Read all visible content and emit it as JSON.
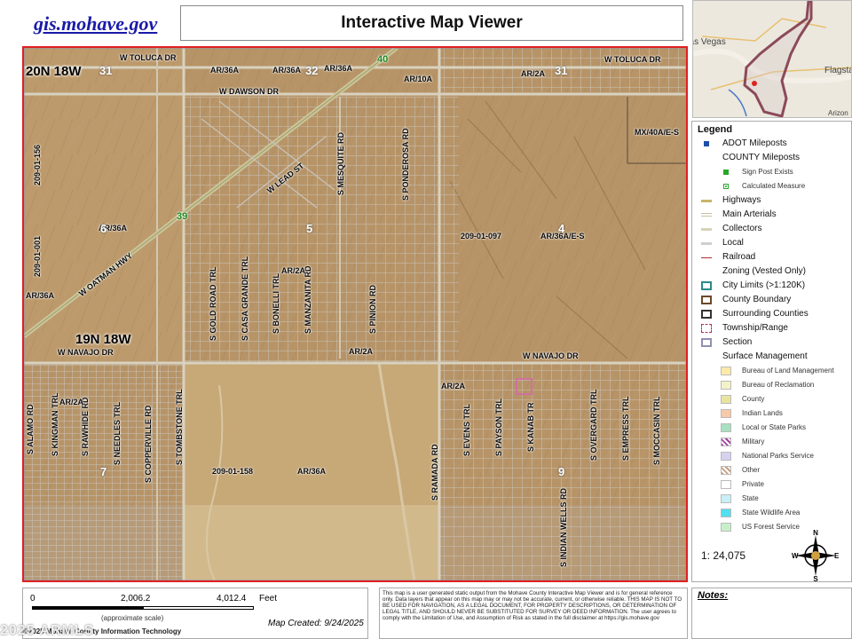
{
  "header": {
    "logo": "gis.mohave.gov",
    "title": "Interactive Map Viewer"
  },
  "overview": {
    "labels": [
      "Las Vegas",
      "Flagstaff",
      "Arizon"
    ]
  },
  "map": {
    "roads": {
      "toluca_w": "W TOLUCA DR",
      "toluca_e": "W TOLUCA DR",
      "dawson": "W DAWSON DR",
      "lead": "W LEAD ST",
      "oatman": "W OATMAN HWY",
      "navajo_w": "W NAVAJO DR",
      "navajo_e": "W NAVAJO DR",
      "mesquite": "S MESQUITE RD",
      "ponderosa": "S PONDEROSA RD",
      "gold_road": "S GOLD ROAD TRL",
      "casa_grande": "S CASA GRANDE TRL",
      "bonelli": "S BONELLI TRL",
      "manzanita": "S MANZANITA RD",
      "pinion": "S PINION RD",
      "kingman": "S KINGMAN TRL",
      "rawhide": "S RAWHIDE RD",
      "needles": "S NEEDLES TRL",
      "copperville": "S COPPERVILLE RD",
      "tombstone": "S TOMBSTONE TRL",
      "ramada": "S RAMADA RD",
      "evens": "S EVENS TRL",
      "payson": "S PAYSON TRL",
      "kanab": "S KANAB TR",
      "indian_wells": "S INDIAN WELLS RD",
      "overgard": "S OVERGARD TRL",
      "empress": "S EMPRESS TRL",
      "moccasin": "S MOCCASIN TRL",
      "alamo": "S ALAMO RD"
    },
    "zoning": {
      "ar36a": "AR/36A",
      "ar2a": "AR/2A",
      "ar10a": "AR/10A",
      "ar36aes": "AR/36A/E-S",
      "mx40aes": "MX/40A/E-S"
    },
    "parcels": {
      "p097": "209-01-097",
      "p158": "209-01-158",
      "p156": "209-01-156",
      "p001": "209-01-001"
    },
    "township": {
      "t20n": "20N 18W",
      "t19n": "19N 18W"
    },
    "sections": {
      "s31": "31",
      "s32": "32",
      "s31b": "31",
      "s6": "6",
      "s5": "5",
      "s4": "4",
      "s7": "7",
      "s9": "9"
    },
    "mileposts": {
      "m40": "40",
      "m39": "39"
    }
  },
  "legend": {
    "title": "Legend",
    "items": [
      {
        "label": "ADOT Mileposts",
        "style": "sq",
        "color": "#1f4fa8",
        "small": false
      },
      {
        "label": "COUNTY Mileposts",
        "style": "none",
        "color": "",
        "small": false
      },
      {
        "label": "Sign Post Exists",
        "style": "sq",
        "color": "#2aa62a",
        "small": true
      },
      {
        "label": "Calculated Measure",
        "style": "dot",
        "color": "#2aa62a",
        "small": true
      },
      {
        "label": "Highways",
        "style": "line",
        "color": "#c9b46a",
        "small": false
      },
      {
        "label": "Main Arterials",
        "style": "dbl",
        "color": "#c9c0a0",
        "small": false
      },
      {
        "label": "Collectors",
        "style": "line",
        "color": "#d9d2b8",
        "small": false
      },
      {
        "label": "Local",
        "style": "line",
        "color": "#cfcfcf",
        "small": false
      },
      {
        "label": "Railroad",
        "style": "rail",
        "color": "#b03030",
        "small": false
      },
      {
        "label": "Zoning (Vested Only)",
        "style": "none",
        "color": "",
        "small": false
      },
      {
        "label": "City Limits (>1:120K)",
        "style": "box",
        "color": "#2a8a8a",
        "small": false
      },
      {
        "label": "County Boundary",
        "style": "box",
        "color": "#6a4a2a",
        "small": false
      },
      {
        "label": "Surrounding Counties",
        "style": "box",
        "color": "#333333",
        "small": false
      },
      {
        "label": "Township/Range",
        "style": "dash",
        "color": "#b03050",
        "small": false
      },
      {
        "label": "Section",
        "style": "box",
        "color": "#9090b0",
        "small": false
      },
      {
        "label": "Surface Management",
        "style": "none",
        "color": "",
        "small": false
      },
      {
        "label": "Bureau of Land Management",
        "style": "fill",
        "color": "#fde9a8",
        "small": true
      },
      {
        "label": "Bureau of Reclamation",
        "style": "fill",
        "color": "#f2f2c8",
        "small": true
      },
      {
        "label": "County",
        "style": "fill",
        "color": "#e8e4a0",
        "small": true
      },
      {
        "label": "Indian Lands",
        "style": "fill",
        "color": "#f7c9a8",
        "small": true
      },
      {
        "label": "Local or State Parks",
        "style": "fill",
        "color": "#a8e0c0",
        "small": true
      },
      {
        "label": "Military",
        "style": "hatch",
        "color": "#a040a0",
        "small": true
      },
      {
        "label": "National Parks Service",
        "style": "fill",
        "color": "#d8d0f0",
        "small": true
      },
      {
        "label": "Other",
        "style": "hatch",
        "color": "#c8a080",
        "small": true
      },
      {
        "label": "Private",
        "style": "fill",
        "color": "#ffffff",
        "small": true
      },
      {
        "label": "State",
        "style": "fill",
        "color": "#c8f0f8",
        "small": true
      },
      {
        "label": "State Wildlife Area",
        "style": "fill",
        "color": "#50e0f0",
        "small": true
      },
      {
        "label": "US Forest Service",
        "style": "fill",
        "color": "#c8f0c8",
        "small": true
      }
    ],
    "scale": "1: 24,075",
    "compass": {
      "n": "N",
      "s": "S",
      "e": "E",
      "w": "W"
    }
  },
  "scalebar": {
    "n0": "0",
    "n1": "2,006.2",
    "n2": "4,012.4",
    "unit": "Feet",
    "approx": "(approximate scale)",
    "created": "Map Created: 9/24/2025",
    "copyright": "©2025 Mohave County Information Technology"
  },
  "disclaimer": "This map is a user generated static output from the Mohave County Interactive Map Viewer and is for general reference only. Data layers that appear on this map may or may not be accurate, current, or otherwise reliable. THIS MAP IS NOT TO BE USED FOR NAVIGATION, AS A LEGAL DOCUMENT, FOR PROPERTY DESCRIPTIONS, OR DETERMINATION OF LEGAL TITLE, AND SHOULD NEVER BE SUBSTITUTED FOR SURVEY OR DEED INFORMATION. The user agrees to comply with the Limitation of Use, and Assumption of Risk as stated in the full disclaimer at https://gis.mohave.gov",
  "notes": "Notes:",
  "watermark": "2025 ARMLS"
}
